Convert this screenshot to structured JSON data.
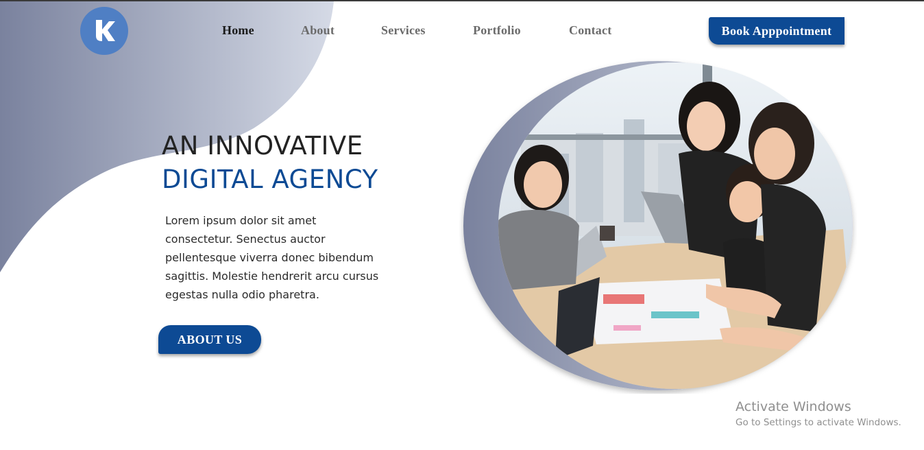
{
  "brand": {
    "logo_letter": "K"
  },
  "nav": {
    "items": [
      "Home",
      "About",
      "Services",
      "Portfolio",
      "Contact"
    ],
    "active_index": 0,
    "cta_label": "Book Apppointment"
  },
  "hero": {
    "title_line1": "AN INNOVATIVE",
    "title_line2": "DIGITAL AGENCY",
    "paragraph": "Lorem ipsum dolor sit amet consectetur. Senectus auctor pellentesque viverra donec bibendum sagittis. Molestie hendrerit arcu cursus egestas nulla odio pharetra.",
    "button_label": "ABOUT US"
  },
  "watermark": {
    "title": "Activate Windows",
    "subtitle": "Go to Settings to activate Windows."
  },
  "colors": {
    "accent": "#0d4a94",
    "logo": "#4f7fc4",
    "blob_dark": "#7a829e",
    "blob_light": "#d5dae6"
  }
}
